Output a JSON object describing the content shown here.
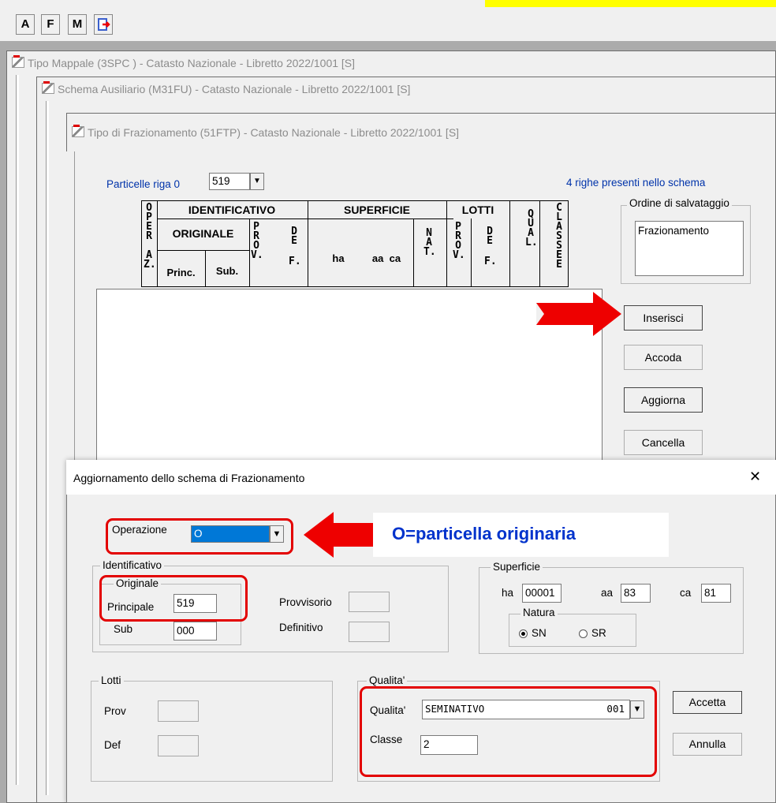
{
  "toolbar": {
    "buttons": [
      "A",
      "F",
      "M"
    ],
    "exit_icon": "exit-door-icon"
  },
  "windows": {
    "win1_title": "Tipo Mappale (3SPC ) - Catasto Nazionale - Libretto 2022/1001 [S]",
    "win2_title": "Schema Ausiliario (M31FU) - Catasto Nazionale - Libretto 2022/1001 [S]",
    "win3_title": "Tipo di Frazionamento (51FTP) - Catasto Nazionale - Libretto 2022/1001 [S]"
  },
  "schema": {
    "particelle_label": "Particelle riga 0",
    "particelle_value": "519",
    "righe_info": "4 righe presenti nello schema",
    "ordine_label": "Ordine di salvataggio",
    "ordine_value": "Frazionamento",
    "headers": {
      "operaz": [
        "O",
        "P",
        "E",
        "R",
        "A",
        "Z."
      ],
      "identificativo": "IDENTIFICATIVO",
      "originale": "ORIGINALE",
      "princ": "Princ.",
      "sub": "Sub.",
      "prov": [
        "P",
        "R",
        "O",
        "V."
      ],
      "def": [
        "D",
        "E",
        "F."
      ],
      "superficie": "SUPERFICIE",
      "ha": "ha",
      "aa_ca": "aa  ca",
      "nat": [
        "N",
        "A",
        "T."
      ],
      "lotti": "LOTTI",
      "lotti_prov": [
        "P",
        "R",
        "O",
        "V."
      ],
      "lotti_def": [
        "D",
        "E",
        "F."
      ],
      "qual": [
        "Q",
        "U",
        "A",
        "L."
      ],
      "classe": [
        "C",
        "L",
        "A",
        "S",
        "S",
        "E"
      ]
    },
    "buttons": {
      "inserisci": "Inserisci",
      "accoda": "Accoda",
      "aggiorna": "Aggiorna",
      "cancella": "Cancella"
    }
  },
  "dialog": {
    "title": "Aggiornamento dello schema di Frazionamento",
    "close": "✕",
    "operazione_label": "Operazione",
    "operazione_value": "O",
    "callout": "O=particella originaria",
    "identificativo_label": "Identificativo",
    "originale_label": "Originale",
    "principale_label": "Principale",
    "principale_value": "519",
    "sub_label": "Sub",
    "sub_value": "000",
    "provvisorio_label": "Provvisorio",
    "definitivo_label": "Definitivo",
    "superficie_label": "Superficie",
    "ha_label": "ha",
    "ha_value": "00001",
    "aa_label": "aa",
    "aa_value": "83",
    "ca_label": "ca",
    "ca_value": "81",
    "natura_label": "Natura",
    "sn_label": "SN",
    "sr_label": "SR",
    "natura_selected": "SN",
    "lotti_label": "Lotti",
    "prov_label": "Prov",
    "def_label": "Def",
    "qualita_group_label": "Qualita'",
    "qualita_label": "Qualita'",
    "qualita_value": "SEMINATIVO",
    "qualita_code": "001",
    "classe_label": "Classe",
    "classe_value": "2",
    "accetta": "Accetta",
    "annulla": "Annulla"
  },
  "colors": {
    "highlight_red": "#e30000",
    "callout_text": "#0033cc",
    "yellow_band": "#ffff00",
    "selection_blue": "#0078d7"
  }
}
